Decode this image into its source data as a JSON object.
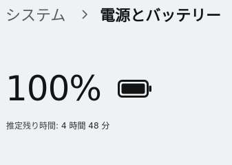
{
  "breadcrumb": {
    "parent": "システム",
    "separator_icon": "chevron-right-icon",
    "current": "電源とバッテリー"
  },
  "battery": {
    "percent_text": "100%",
    "charge_fraction": 1.0,
    "icon": "battery-full-icon",
    "remaining_label": "推定残り時間:",
    "remaining_value": "4 時間 48 分"
  }
}
